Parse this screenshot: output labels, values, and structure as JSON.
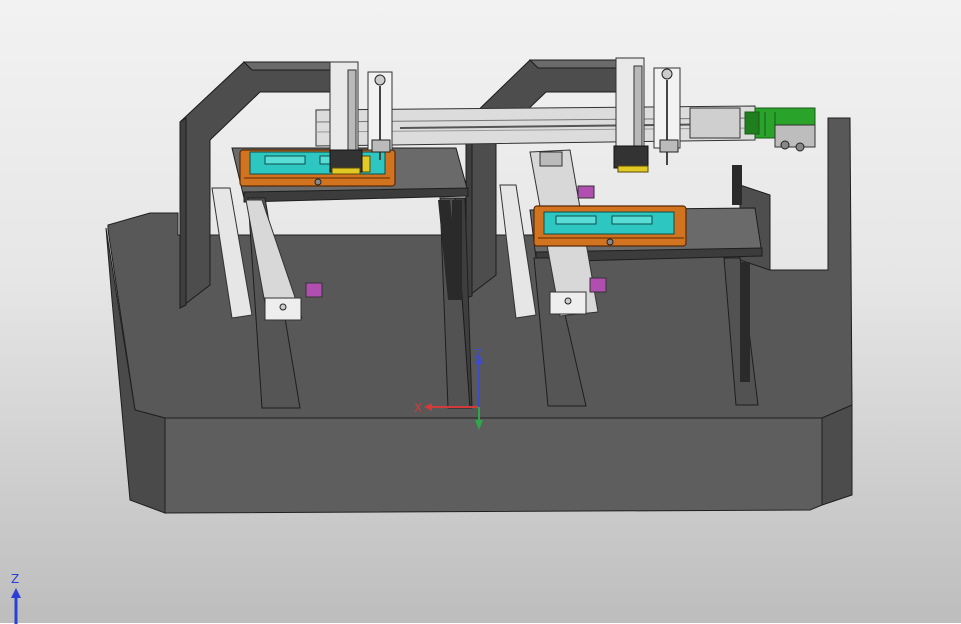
{
  "viewport": {
    "background_top": "#f2f2f2",
    "background_bottom": "#bdbdbd"
  },
  "model": {
    "description_colors": {
      "base": "#555555",
      "frame": "#4b4b4b",
      "tray": "#d2731f",
      "insert": "#2ec6c0",
      "motor": "#2aa32a",
      "rail": "#e8e8e8",
      "clamp": "#b04fb0"
    }
  },
  "origin_axes": {
    "x_label": "X",
    "z_label": "Z",
    "x_color": "#d33a3a",
    "y_color": "#2ea84a",
    "z_color": "#3e4cc9"
  },
  "view_triad": {
    "z_label": "Z",
    "z_color": "#2c3fd6",
    "arrow_icon": "up-arrow-icon"
  }
}
